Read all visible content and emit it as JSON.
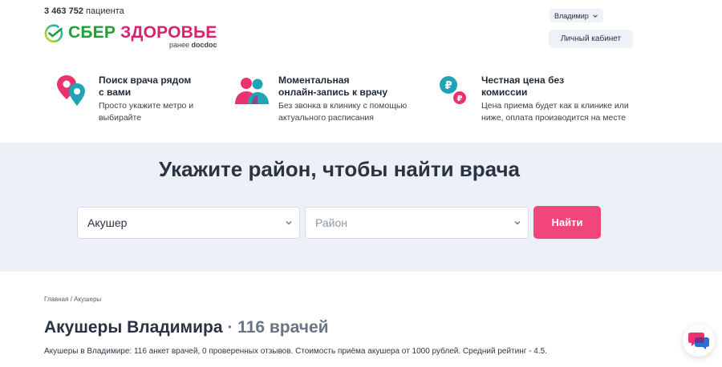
{
  "header": {
    "patients_count": "3 463 752",
    "patients_label": "пациента",
    "logo_sber": "СБЕР",
    "logo_zdorovye": "ЗДОРОВЬЕ",
    "logo_formerly": "ранее",
    "logo_formerly_brand": "docdoc",
    "city": "Владимир",
    "cabinet_label": "Личный кабинет",
    "brand_colors": {
      "green": "#21a038",
      "pink": "#d6246e",
      "accent": "#f2457b"
    }
  },
  "features": [
    {
      "icon": "location-pins-icon",
      "title": "Поиск врача рядом\nс вами",
      "desc": "Просто укажите метро и\nвыбирайте"
    },
    {
      "icon": "people-icon",
      "title": "Моментальная\nонлайн-запись к врачу",
      "desc": "Без звонка в клинику с помощью\nактуального расписания"
    },
    {
      "icon": "ruble-coins-icon",
      "title": "Честная цена без\nкомиссии",
      "desc": "Цена приема будет как в клинике или\nниже, оплата производится на месте"
    }
  ],
  "search": {
    "title": "Укажите район, чтобы найти врача",
    "specialty_value": "Акушер",
    "district_placeholder": "Район",
    "find_button": "Найти"
  },
  "breadcrumb": {
    "home": "Главная",
    "separator": "/",
    "current": "Акушеры"
  },
  "page": {
    "title": "Акушеры Владимира",
    "count": "· 116 врачей",
    "summary": "Акушеры в Владимире: 116 анкет врачей, 0 проверенных отзывов. Стоимость приёма акушера от 1000 рублей. Средний рейтинг - 4.5."
  },
  "chat": {
    "icon": "chat-bubbles-icon"
  }
}
